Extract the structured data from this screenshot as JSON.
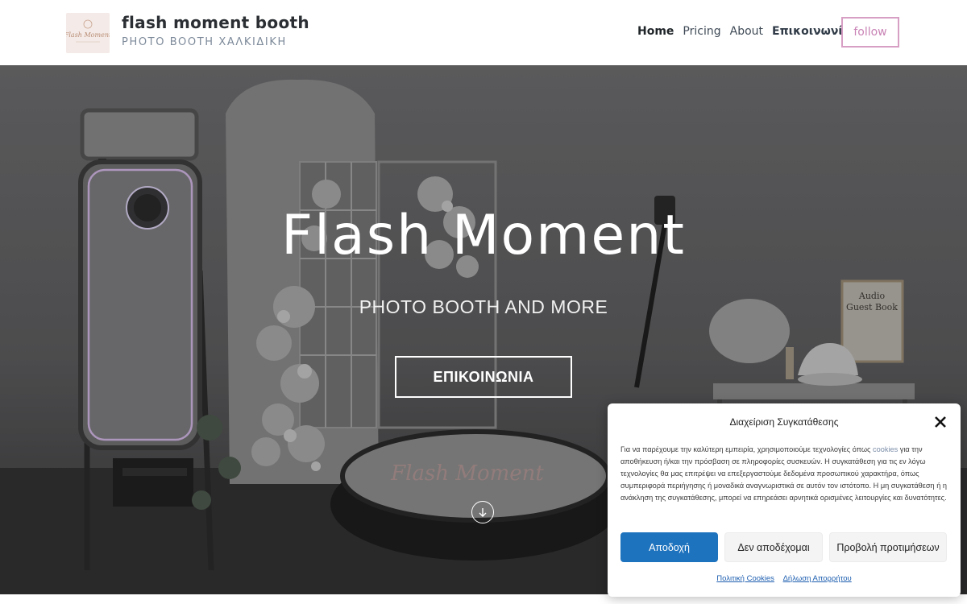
{
  "header": {
    "logo_text": "Flash Moment",
    "brand_title": "flash moment booth",
    "brand_subtitle": "PHOTO BOOTH ΧΑΛΚΙΔΙΚΗ",
    "nav": [
      {
        "label": "Home"
      },
      {
        "label": "Pricing"
      },
      {
        "label": "About"
      },
      {
        "label": "Επικοινωνία"
      }
    ],
    "follow_label": "follow"
  },
  "hero": {
    "title": "Flash Moment",
    "subtitle": "PHOTO BOOTH AND MORE",
    "cta_label": "ΕΠΙΚΟΙΝΩΝΙΑ",
    "scroll_icon": "arrow-down-circle-icon",
    "sign_line1": "Audio",
    "sign_line2": "Guest Book",
    "platform_text": "Flash Moment"
  },
  "cookie": {
    "title": "Διαχείριση Συγκατάθεσης",
    "text_before": "Για να παρέχουμε την καλύτερη εμπειρία, χρησιμοποιούμε τεχνολογίες όπως ",
    "text_link": "cookies",
    "text_after": " για την αποθήκευση ή/και την πρόσβαση σε πληροφορίες συσκευών. Η συγκατάθεση για τις εν λόγω τεχνολογίες θα μας επιτρέψει να επεξεργαστούμε δεδομένα προσωπικού χαρακτήρα, όπως συμπεριφορά περιήγησης ή μοναδικά αναγνωριστικά σε αυτόν τον ιστότοπο. Η μη συγκατάθεση ή η ανάκληση της συγκατάθεσης, μπορεί να επηρεάσει αρνητικά ορισμένες λειτουργίες και δυνατότητες.",
    "accept_label": "Αποδοχή",
    "deny_label": "Δεν αποδέχομαι",
    "prefs_label": "Προβολή προτιμήσεων",
    "policy_link": "Πολιτική Cookies",
    "privacy_link": "Δήλωση Απορρήτου",
    "accent_color": "#1e73be"
  }
}
